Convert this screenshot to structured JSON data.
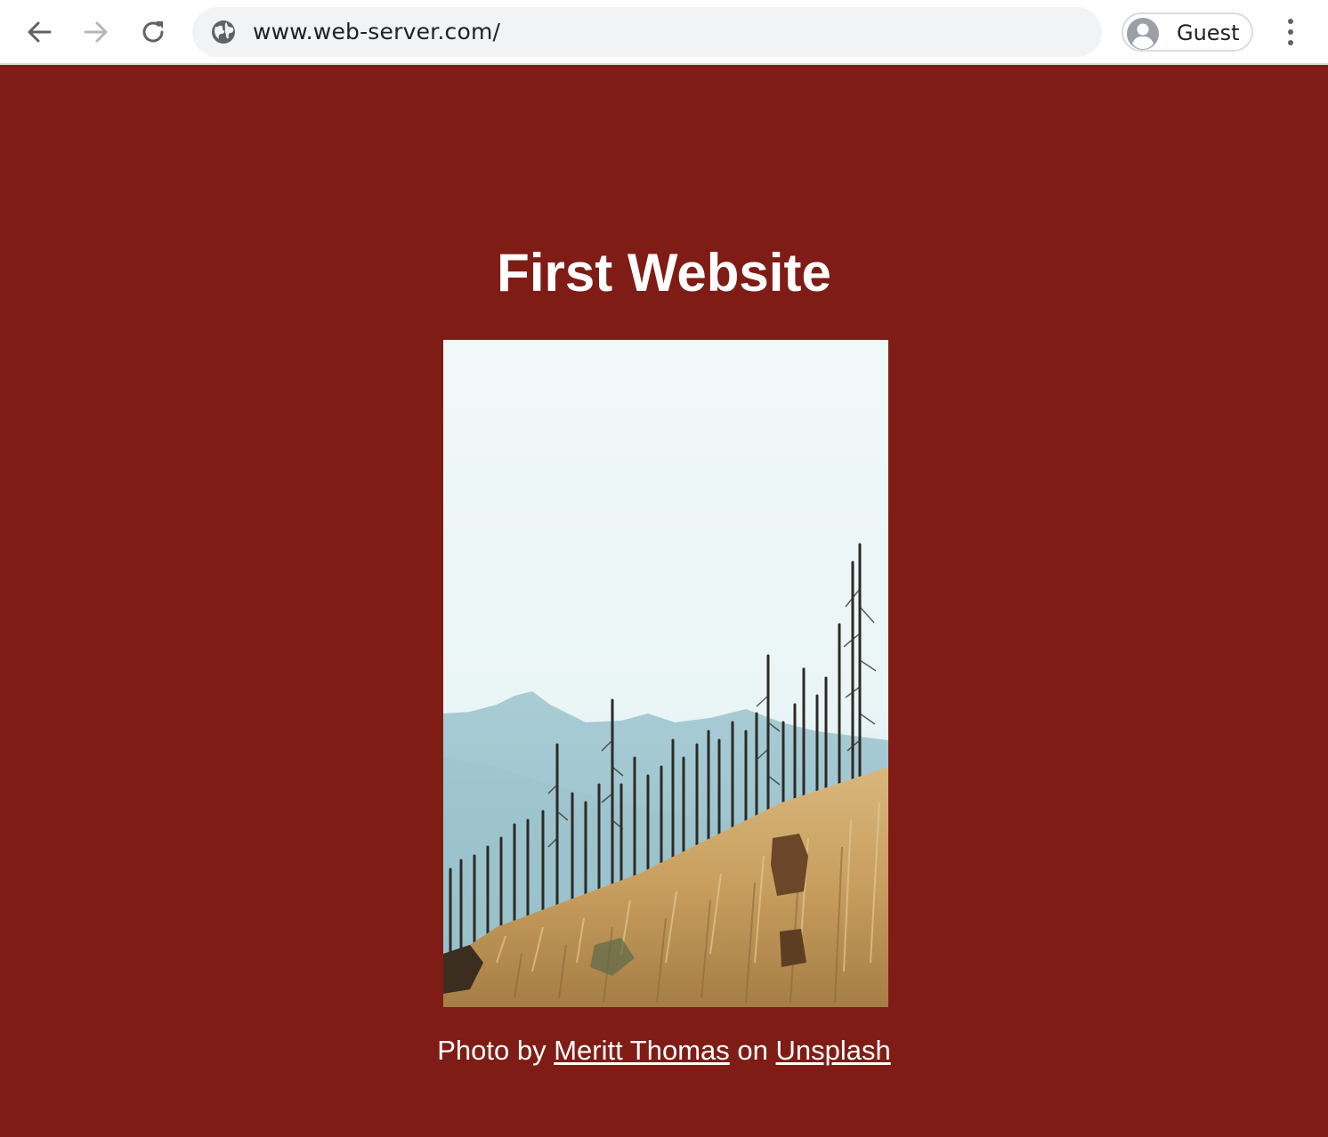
{
  "browser": {
    "url": "www.web-server.com/",
    "profile_label": "Guest",
    "icons": {
      "back": "arrow-left-icon",
      "forward": "arrow-right-icon",
      "reload": "reload-icon",
      "site_info": "globe-icon",
      "profile": "avatar-icon",
      "menu": "kebab-menu-icon"
    }
  },
  "page": {
    "background_color": "#7f1c16",
    "title": "First Website",
    "photo": {
      "subject": "burned forest on a grassy hillside with misty mountains"
    },
    "credit": {
      "prefix": "Photo by",
      "author": "Meritt Thomas",
      "middle": "on",
      "source": "Unsplash"
    }
  }
}
